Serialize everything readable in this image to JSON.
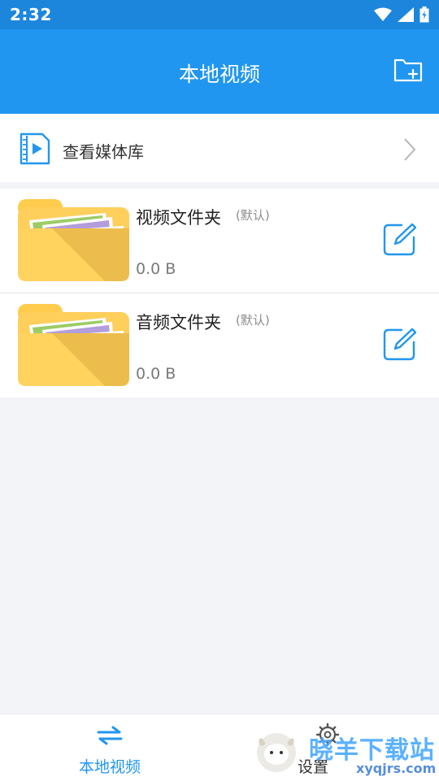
{
  "status_bar": {
    "time": "2:32"
  },
  "app_bar": {
    "title": "本地视频"
  },
  "media_library": {
    "label": "查看媒体库"
  },
  "folders": [
    {
      "name": "视频文件夹",
      "tag": "(默认)",
      "size": "0.0 B"
    },
    {
      "name": "音频文件夹",
      "tag": "(默认)",
      "size": "0.0 B"
    }
  ],
  "bottom_nav": {
    "tabs": [
      {
        "label": "本地视频",
        "active": true
      },
      {
        "label": "设置"
      }
    ]
  },
  "watermark": {
    "text": "晓羊下载站",
    "url": "xyqjrs.com"
  },
  "colors": {
    "primary": "#2196f0",
    "status_bar": "#1c86dd",
    "background": "#f2f4f8"
  }
}
